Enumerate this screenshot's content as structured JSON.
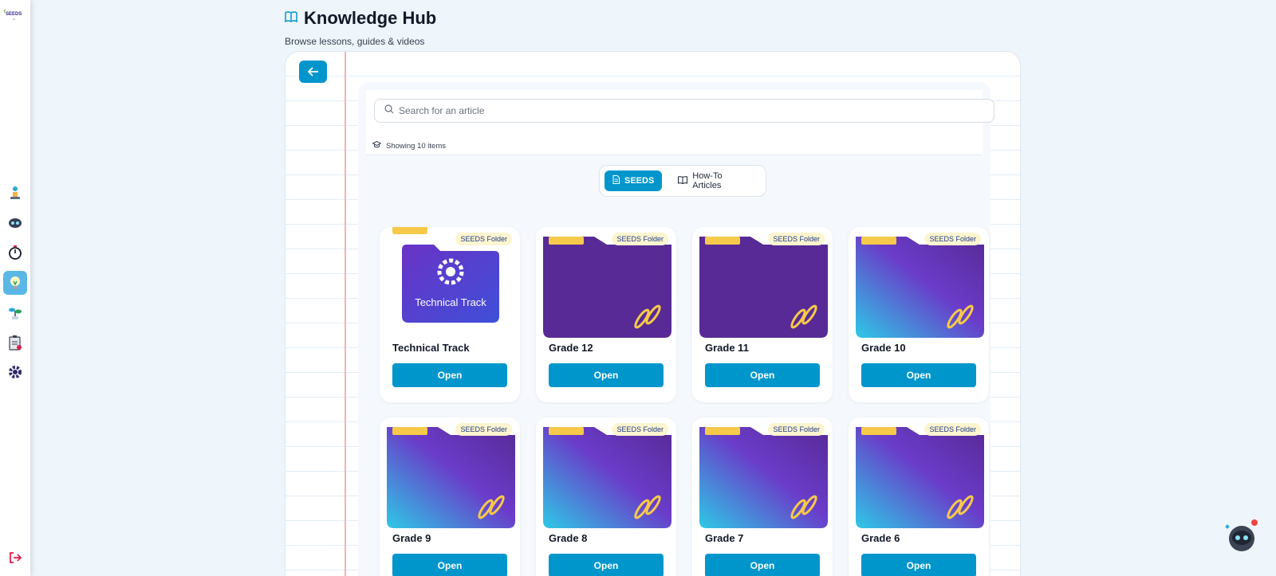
{
  "header": {
    "title": "Knowledge Hub",
    "subtitle": "Browse lessons, guides & videos"
  },
  "sidebar": {
    "logo_text": "SEEDS",
    "items": [
      {
        "name": "robot-agent-icon"
      },
      {
        "name": "eye-bot-icon"
      },
      {
        "name": "stopwatch-icon"
      },
      {
        "name": "lightbulb-icon",
        "active": true
      },
      {
        "name": "plant-icon"
      },
      {
        "name": "clipboard-icon"
      },
      {
        "name": "gear-icon"
      }
    ]
  },
  "search": {
    "placeholder": "Search for an article",
    "showing": "Showing 10 items"
  },
  "tabs": [
    {
      "label": "SEEDS",
      "active": true
    },
    {
      "label": "How-To Articles",
      "active": false
    }
  ],
  "cards": [
    {
      "title": "Technical Track",
      "badge": "SEEDS Folder",
      "button": "Open",
      "thumb_label": "Technical Track"
    },
    {
      "title": "Grade 12",
      "badge": "SEEDS Folder",
      "button": "Open"
    },
    {
      "title": "Grade 11",
      "badge": "SEEDS Folder",
      "button": "Open"
    },
    {
      "title": "Grade 10",
      "badge": "SEEDS Folder",
      "button": "Open"
    },
    {
      "title": "Grade 9",
      "badge": "SEEDS Folder",
      "button": "Open"
    },
    {
      "title": "Grade 8",
      "badge": "SEEDS Folder",
      "button": "Open"
    },
    {
      "title": "Grade 7",
      "badge": "SEEDS Folder",
      "button": "Open"
    },
    {
      "title": "Grade 6",
      "badge": "SEEDS Folder",
      "button": "Open"
    }
  ],
  "colors": {
    "accent": "#0096cc",
    "folder_purple": "#572a96",
    "folder_cyan": "#2ec9e6",
    "folder_tab": "#f6c94a"
  }
}
